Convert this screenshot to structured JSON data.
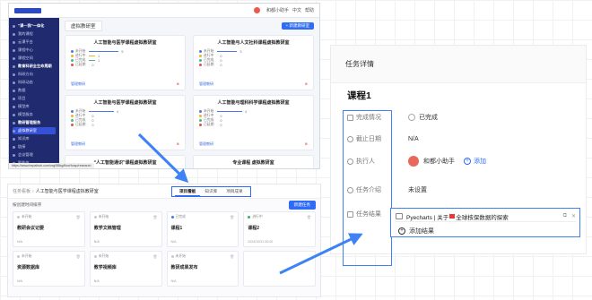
{
  "screen_a": {
    "top_bar": {
      "user": "和都小助手",
      "links": [
        "中文",
        "帮助"
      ]
    },
    "sidebar": {
      "items": [
        {
          "label": "“课—我”一体化",
          "kind": "grp"
        },
        {
          "label": "我的课程",
          "kind": ""
        },
        {
          "label": "云课平台",
          "kind": ""
        },
        {
          "label": "课程中心",
          "kind": ""
        },
        {
          "label": "课程空间",
          "kind": ""
        },
        {
          "label": "教育科研全生命周期",
          "kind": "grp"
        },
        {
          "label": "科研方向",
          "kind": ""
        },
        {
          "label": "科研动态",
          "kind": ""
        },
        {
          "label": "数据",
          "kind": ""
        },
        {
          "label": "项目",
          "kind": ""
        },
        {
          "label": "模型库",
          "kind": ""
        },
        {
          "label": "模型服务",
          "kind": ""
        },
        {
          "label": "教研管理服务",
          "kind": "grp"
        },
        {
          "label": "虚拟教研室",
          "kind": "on"
        },
        {
          "label": "知识库",
          "kind": ""
        },
        {
          "label": "链接",
          "kind": ""
        },
        {
          "label": "会议管理",
          "kind": ""
        },
        {
          "label": "智能体",
          "kind": ""
        },
        {
          "label": "知识图谱",
          "kind": ""
        }
      ]
    },
    "title": "虚拟教研室",
    "new_button": "+ 新建教研室",
    "cards": [
      {
        "title": "人工智能与医学课程虚拟教研室",
        "stats": [
          {
            "label": "未开始",
            "value": "5",
            "color": "#4a78e6",
            "fill": 0.6
          },
          {
            "label": "进行中",
            "value": "1",
            "color": "#f0b428",
            "fill": 0.12
          },
          {
            "label": "已完成",
            "value": "1",
            "color": "#3fbf7f",
            "fill": 0.12
          },
          {
            "label": "已延期",
            "value": "0",
            "color": "#e15050",
            "fill": 0
          }
        ],
        "link": "管理教研"
      },
      {
        "title": "人工智能与人文社科课程虚拟教研室",
        "stats": [
          {
            "label": "未开始",
            "value": "3",
            "color": "#4a78e6",
            "fill": 0.4
          },
          {
            "label": "进行中",
            "value": "0",
            "color": "#f0b428",
            "fill": 0
          },
          {
            "label": "已完成",
            "value": "0",
            "color": "#3fbf7f",
            "fill": 0
          },
          {
            "label": "已延期",
            "value": "0",
            "color": "#e15050",
            "fill": 0
          }
        ],
        "link": "管理教研"
      },
      {
        "title": "人工智能与医学课程虚拟教研室",
        "stats": [
          {
            "label": "未开始",
            "value": "4",
            "color": "#4a78e6",
            "fill": 0.5
          },
          {
            "label": "进行中",
            "value": "0",
            "color": "#f0b428",
            "fill": 0
          },
          {
            "label": "已完成",
            "value": "0",
            "color": "#3fbf7f",
            "fill": 0
          },
          {
            "label": "已延期",
            "value": "0",
            "color": "#e15050",
            "fill": 0
          }
        ],
        "link": "管理教研"
      },
      {
        "title": "人工智能与理科科学课程虚拟教研室",
        "stats": [
          {
            "label": "未开始",
            "value": "4",
            "color": "#4a78e6",
            "fill": 0.5
          },
          {
            "label": "进行中",
            "value": "0",
            "color": "#f0b428",
            "fill": 0
          },
          {
            "label": "已完成",
            "value": "0",
            "color": "#3fbf7f",
            "fill": 0
          },
          {
            "label": "已延期",
            "value": "0",
            "color": "#e15050",
            "fill": 0
          }
        ],
        "link": "管理教研"
      },
      {
        "title": "“人工智能通识”课程虚拟教研室",
        "stats": [],
        "link": ""
      },
      {
        "title": "专业课程 虚拟教研室",
        "stats": [],
        "link": ""
      }
    ],
    "status_url": "https://www.hepaihub.com/org/5Bkg/flow/hosp/research"
  },
  "screen_b": {
    "breadcrumb": "任务看板",
    "page": "人工智能与医学课程虚拟教研室",
    "tabs": [
      {
        "label": "项目看板",
        "active": true
      },
      {
        "label": "知识库",
        "active": false
      },
      {
        "label": "项目成果",
        "active": false
      }
    ],
    "sort": "按创建时间排序",
    "new_task": "新建任务",
    "tasks": [
      {
        "status": "未开始",
        "state": "",
        "title": "教研会议记要",
        "meta": "N/A"
      },
      {
        "status": "未开始",
        "state": "",
        "title": "教学文档管理",
        "meta": "N/A"
      },
      {
        "status": "已完成",
        "state": "done",
        "title": "课程1",
        "meta": "N/A"
      },
      {
        "status": "进行中",
        "state": "run",
        "title": "课程2",
        "meta": "2024/10/31 00:00"
      },
      {
        "status": "未开始",
        "state": "",
        "title": "资源数据库",
        "meta": "N/A"
      },
      {
        "status": "未开始",
        "state": "",
        "title": "教学视频库",
        "meta": "N/A"
      },
      {
        "status": "未开始",
        "state": "",
        "title": "教研成果发布",
        "meta": "N/A"
      },
      {
        "status": "",
        "state": "",
        "title": "",
        "meta": ""
      }
    ]
  },
  "detail": {
    "header": "任务详情",
    "title": "课程1",
    "rows": {
      "status": {
        "label": "完成情况",
        "value": "已完成"
      },
      "due": {
        "label": "截止日期",
        "value": "N/A"
      },
      "owner": {
        "label": "执行人",
        "value": "和都小助手",
        "add": "添加"
      },
      "intro": {
        "label": "任务介绍",
        "value": "未设置"
      },
      "result": {
        "label": "任务结果"
      }
    },
    "result_item": {
      "prefix": "Pyecharts | 关于",
      "suffix": "全球核保数据的探索"
    },
    "add_result": "添加结果"
  },
  "colors": {
    "accent": "#2f6cf5",
    "highlight": "#3e83f5",
    "sidebar": "#1f2b6e"
  }
}
